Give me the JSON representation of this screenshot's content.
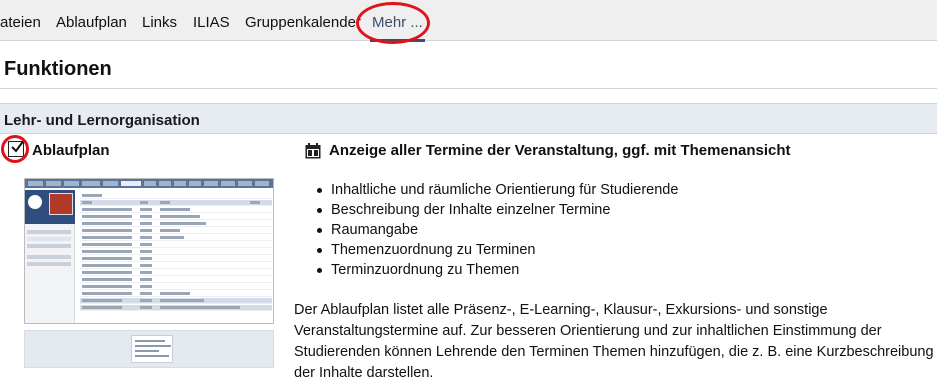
{
  "tabs": [
    {
      "label": "ateien"
    },
    {
      "label": "Ablaufplan"
    },
    {
      "label": "Links"
    },
    {
      "label": "ILIAS"
    },
    {
      "label": "Gruppenkalender"
    },
    {
      "label": "Mehr ..."
    }
  ],
  "page": {
    "title": "Funktionen"
  },
  "section": {
    "title": "Lehr- und Lernorganisation"
  },
  "module": {
    "label": "Ablaufplan",
    "checked": true,
    "description_title": "Anzeige aller Termine der Veranstaltung, ggf. mit Themenansicht",
    "features": [
      "Inhaltliche und räumliche Orientierung für Studierende",
      "Beschreibung der Inhalte einzelner Termine",
      "Raumangabe",
      "Themenzuordnung zu Terminen",
      "Terminzuordnung zu Themen"
    ],
    "description": "Der Ablaufplan listet alle Präsenz-, E-Learning-, Klausur-, Exkursions- und sonstige Veranstaltungstermine auf. Zur besseren Orientierung und zur inhaltlichen Einstimmung der Studierenden können Lehrende den Terminen Themen hinzufügen, die z. B. eine Kurzbeschreibung der Inhalte darstellen."
  },
  "icons": {
    "module_icon": "calendar-icon",
    "checkbox": "checkbox-checked-icon"
  },
  "colors": {
    "tab_active": "#3d4e66",
    "section_bg": "#e6ecf2",
    "annotation": "#e0131b"
  }
}
